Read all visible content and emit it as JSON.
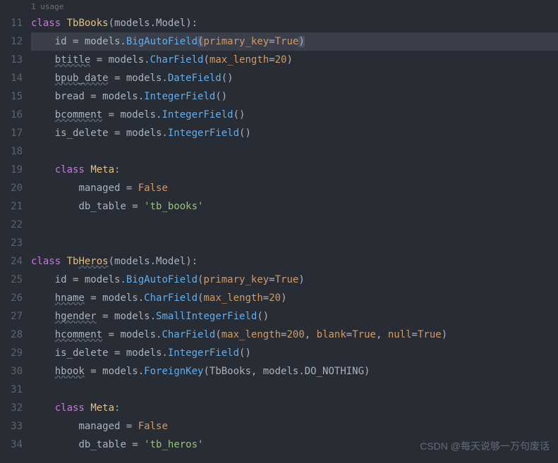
{
  "usage_hint": "1 usage",
  "line_numbers": [
    "11",
    "12",
    "13",
    "14",
    "15",
    "16",
    "17",
    "18",
    "19",
    "20",
    "21",
    "22",
    "23",
    "24",
    "25",
    "26",
    "27",
    "28",
    "29",
    "30",
    "31",
    "32",
    "33",
    "34"
  ],
  "watermark": "CSDN @每天说够一万句废话",
  "code": {
    "l11": {
      "kw_class": "class",
      "cls": "TbBooks",
      "p1": "(models.",
      "p2": "Model",
      "p3": "):"
    },
    "l12": {
      "var": "id",
      "eq": " = models.",
      "fn": "BigAutoField",
      "po": "(",
      "param": "primary_key",
      "as": "=",
      "bool": "True",
      "pc": ")"
    },
    "l13": {
      "var": "btitle",
      "eq": " = models.",
      "fn": "CharField",
      "po": "(",
      "param": "max_length",
      "as": "=",
      "num": "20",
      "pc": ")"
    },
    "l14": {
      "var": "bpub_date",
      "eq": " = models.",
      "fn": "DateField",
      "po": "()",
      "pc": ""
    },
    "l15": {
      "var": "bread",
      "eq": " = models.",
      "fn": "IntegerField",
      "po": "()",
      "pc": ""
    },
    "l16": {
      "var": "bcomment",
      "eq": " = models.",
      "fn": "IntegerField",
      "po": "()",
      "pc": ""
    },
    "l17": {
      "var": "is_delete",
      "eq": " = models.",
      "fn": "IntegerField",
      "po": "()",
      "pc": ""
    },
    "l19": {
      "kw_class": "class",
      "cls": "Meta",
      "colon": ":"
    },
    "l20": {
      "var": "managed",
      "eq": " = ",
      "bool": "False"
    },
    "l21": {
      "var": "db_table",
      "eq": " = ",
      "str": "'tb_books'"
    },
    "l24": {
      "kw_class": "class",
      "cls1": "Tb",
      "cls2": "Heros",
      "p1": "(models.",
      "p2": "Model",
      "p3": "):"
    },
    "l25": {
      "var": "id",
      "eq": " = models.",
      "fn": "BigAutoField",
      "po": "(",
      "param": "primary_key",
      "as": "=",
      "bool": "True",
      "pc": ")"
    },
    "l26": {
      "var": "hname",
      "eq": " = models.",
      "fn": "CharField",
      "po": "(",
      "param": "max_length",
      "as": "=",
      "num": "20",
      "pc": ")"
    },
    "l27": {
      "var": "hgender",
      "eq": " = models.",
      "fn": "SmallIntegerField",
      "po": "()",
      "pc": ""
    },
    "l28": {
      "var": "hcomment",
      "eq": " = models.",
      "fn": "CharField",
      "po": "(",
      "param1": "max_length",
      "as1": "=",
      "num1": "200",
      "c1": ", ",
      "param2": "blank",
      "as2": "=",
      "bool2": "True",
      "c2": ", ",
      "param3": "null",
      "as3": "=",
      "bool3": "True",
      "pc": ")"
    },
    "l29": {
      "var": "is_delete",
      "eq": " = models.",
      "fn": "IntegerField",
      "po": "()",
      "pc": ""
    },
    "l30": {
      "var": "hbook",
      "eq": " = models.",
      "fn": "ForeignKey",
      "po": "(TbBooks, models.DO_NOTHING)",
      "pc": ""
    },
    "l32": {
      "kw_class": "class",
      "cls": "Meta",
      "colon": ":"
    },
    "l33": {
      "var": "managed",
      "eq": " = ",
      "bool": "False"
    },
    "l34": {
      "var": "db_table",
      "eq": " = ",
      "str": "'tb_heros'"
    }
  }
}
